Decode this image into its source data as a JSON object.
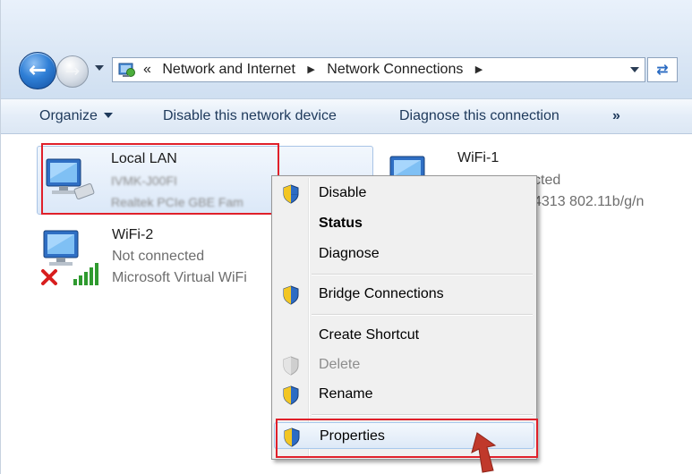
{
  "breadcrumb": {
    "chevrons": "«",
    "items": [
      "Network and Internet",
      "Network Connections"
    ]
  },
  "toolbar": {
    "organize": "Organize",
    "disable": "Disable this network device",
    "diagnose": "Diagnose this connection",
    "more": "»"
  },
  "connections": [
    {
      "name": "Local LAN",
      "line1": "IVMK-J00FI",
      "line2": "Realtek PCIe GBE Fam",
      "state": "selected"
    },
    {
      "name": "WiFi-1",
      "line1": "cted",
      "line2": "4313 802.11b/g/n"
    },
    {
      "name": "WiFi-2",
      "line1": "Not connected",
      "line2": "Microsoft Virtual WiFi",
      "state": "disconnected"
    }
  ],
  "context_menu": [
    {
      "label": "Disable",
      "icon": "uac-shield-icon"
    },
    {
      "label": "Status",
      "bold": true
    },
    {
      "label": "Diagnose"
    },
    {
      "label": "Bridge Connections",
      "icon": "uac-shield-icon"
    },
    {
      "label": "Create Shortcut"
    },
    {
      "label": "Delete",
      "icon": "uac-shield-icon",
      "disabled": true
    },
    {
      "label": "Rename",
      "icon": "uac-shield-icon"
    },
    {
      "label": "Properties",
      "icon": "uac-shield-icon",
      "highlighted": true
    }
  ],
  "colors": {
    "highlight_box": "#e0202a",
    "arrow": "#c0392b"
  }
}
